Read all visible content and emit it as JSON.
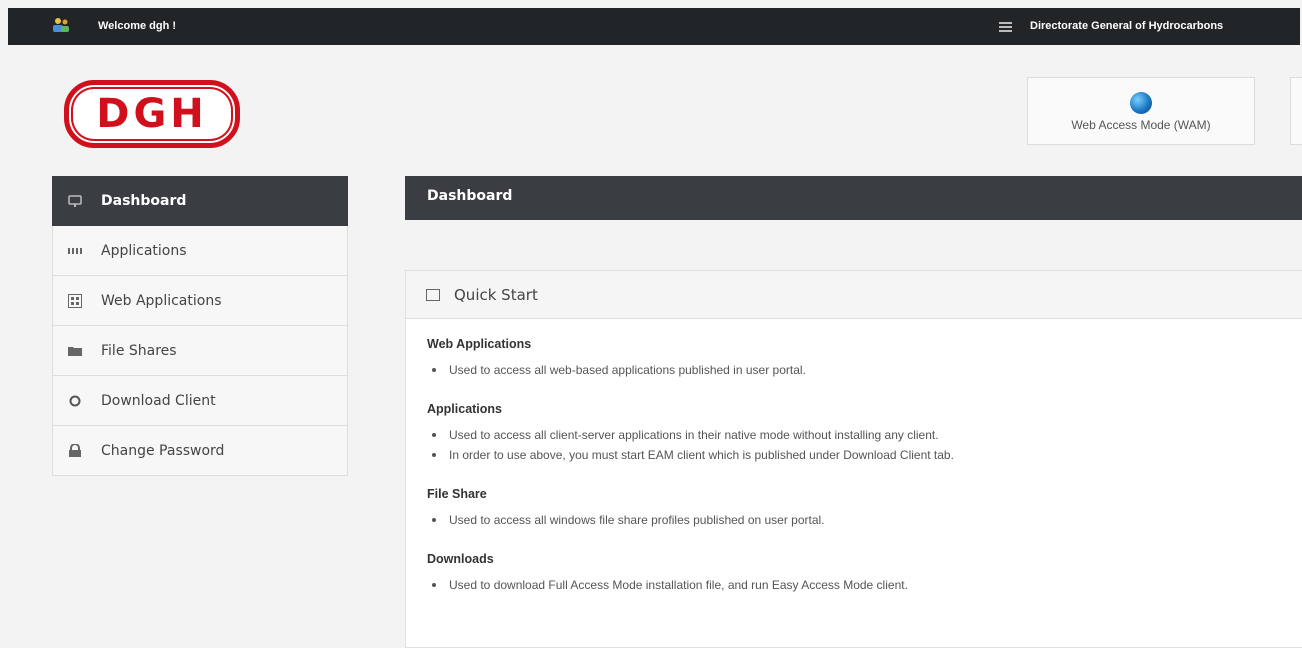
{
  "topbar": {
    "welcome": "Welcome dgh !",
    "organization": "Directorate General of Hydrocarbons"
  },
  "logo": {
    "text": "DGH"
  },
  "mode_buttons": {
    "wam_label": "Web Access Mode (WAM)"
  },
  "sidebar": {
    "items": [
      {
        "label": "Dashboard",
        "icon": "monitor-icon",
        "active": true
      },
      {
        "label": "Applications",
        "icon": "grid-icon"
      },
      {
        "label": "Web Applications",
        "icon": "web-apps-icon"
      },
      {
        "label": "File Shares",
        "icon": "folder-icon"
      },
      {
        "label": "Download Client",
        "icon": "circle-icon"
      },
      {
        "label": "Change Password",
        "icon": "lock-icon"
      }
    ]
  },
  "main": {
    "header_title": "Dashboard",
    "quick_start": {
      "title": "Quick Start",
      "sections": [
        {
          "title": "Web Applications",
          "bullets": [
            "Used to access all web-based applications published in user portal."
          ]
        },
        {
          "title": "Applications",
          "bullets": [
            "Used to access all client-server applications in their native mode without installing any client.",
            "In order to use above, you must start EAM client which is published under Download Client tab."
          ]
        },
        {
          "title": "File Share",
          "bullets": [
            "Used to access all windows file share profiles published on user portal."
          ]
        },
        {
          "title": "Downloads",
          "bullets": [
            "Used to download Full Access Mode installation file, and run Easy Access Mode client."
          ]
        }
      ]
    }
  },
  "colors": {
    "topbar": "#222527",
    "active_nav": "#3a3d42",
    "logo_red": "#d0101c"
  }
}
